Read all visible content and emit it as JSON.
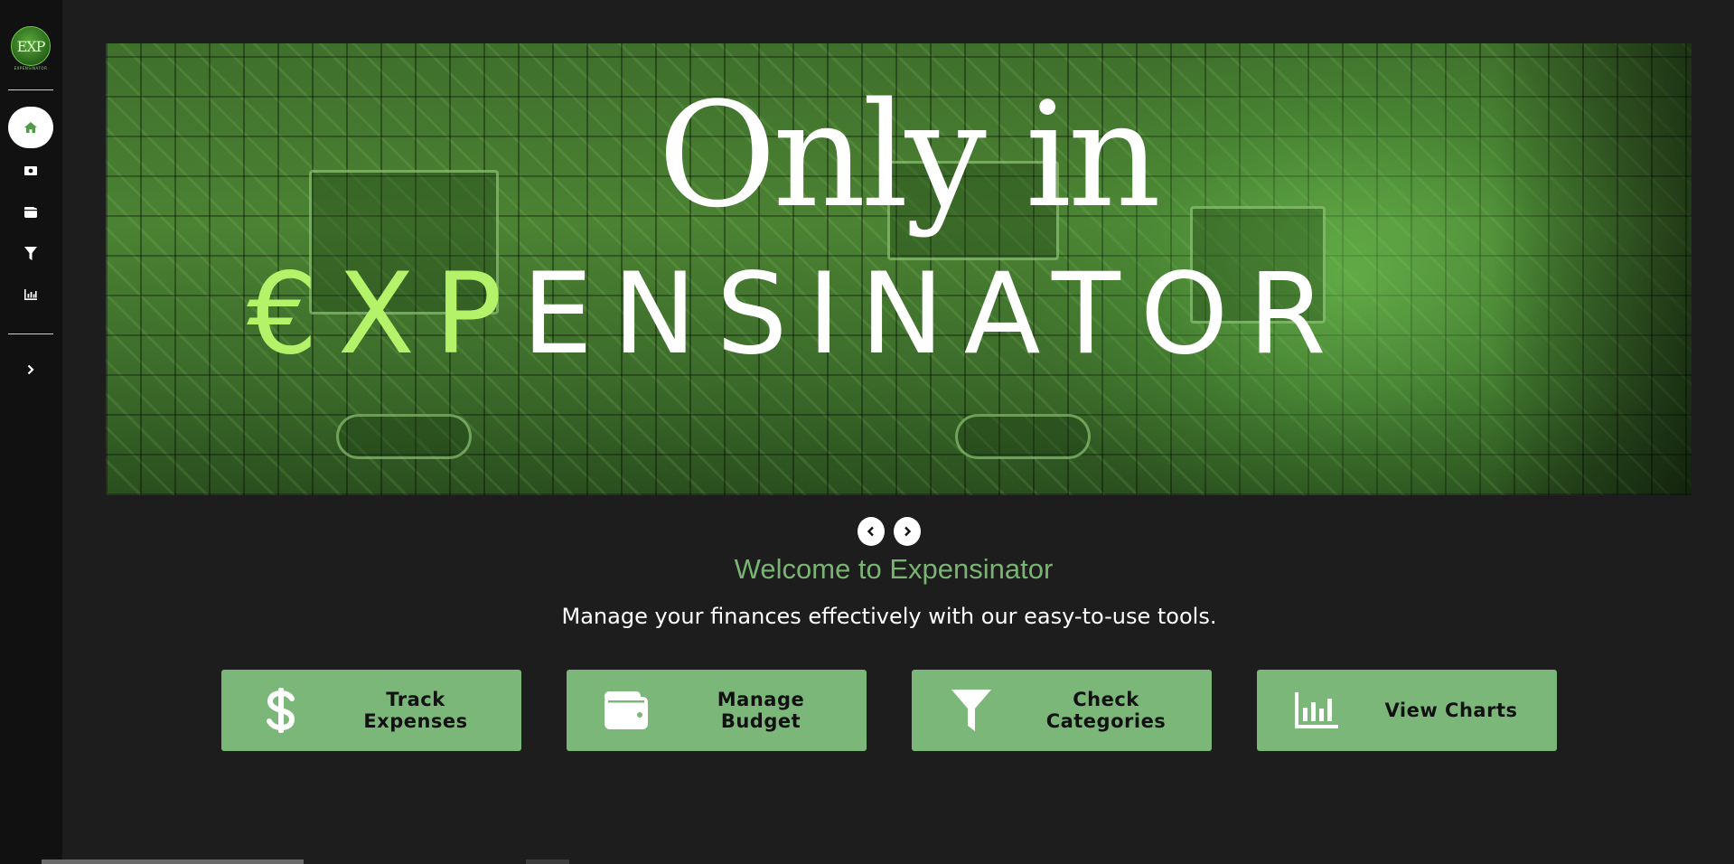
{
  "app": {
    "logo_text": "EXP",
    "logo_caption": "EXPENSINATOR"
  },
  "sidebar": {
    "items": [
      {
        "name": "home",
        "icon": "home-icon"
      },
      {
        "name": "expenses",
        "icon": "money-icon"
      },
      {
        "name": "budget",
        "icon": "wallet-icon"
      },
      {
        "name": "categories",
        "icon": "filter-icon"
      },
      {
        "name": "charts",
        "icon": "chart-icon"
      }
    ],
    "expand_icon": "chevron-right-icon"
  },
  "banner": {
    "line1": "Only in",
    "line2_accent": "€XP",
    "line2_rest": "ENSINATOR"
  },
  "carousel": {
    "prev_icon": "chevron-left-icon",
    "next_icon": "chevron-right-icon"
  },
  "welcome": {
    "title": "Welcome to Expensinator",
    "subtitle": "Manage your finances effectively with our easy-to-use tools."
  },
  "actions": [
    {
      "label_line1": "Track",
      "label_line2": "Expenses",
      "icon": "dollar-icon"
    },
    {
      "label_line1": "Manage",
      "label_line2": "Budget",
      "icon": "wallet-icon"
    },
    {
      "label_line1": "Check",
      "label_line2": "Categories",
      "icon": "filter-icon"
    },
    {
      "label_line1": "View Charts",
      "label_line2": "",
      "icon": "chart-icon"
    }
  ],
  "colors": {
    "accent_green": "#7cb77a",
    "welcome_green": "#79b473",
    "banner_accent": "#b4f26a",
    "background": "#1d1d1d",
    "sidebar": "#111111"
  }
}
